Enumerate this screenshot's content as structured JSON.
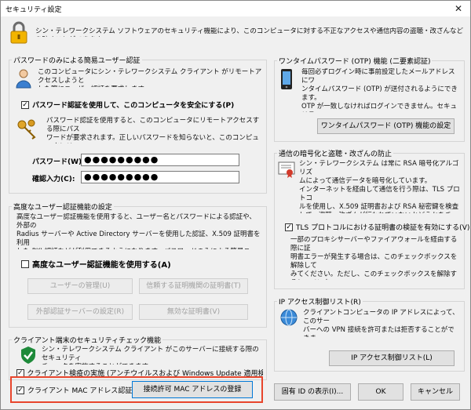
{
  "window": {
    "title": "セキュリティ設定",
    "close_glyph": "✕"
  },
  "header": {
    "description": "シン・テレワークシステム ソフトウェアのセキュリティ機能により、このコンピュータに対する不正なアクセスや通信内容の盗聴・改ざんなどを防ぐことができます。"
  },
  "password_auth": {
    "group_label": "パスワードのみによる簡易ユーザー認証",
    "intro": "このコンピュータにシン・テレワークシステム クライアント がリモートアクセスしようと\nした際にユーザー認証を要求します。",
    "checkbox_label": "パスワード認証を使用して、このコンピュータを安全にする(P)",
    "checked": true,
    "detail": "パスワード認証を使用すると、このコンピュータにリモートアクセスする際にパス\nワードが要求されます。正しいパスワードを知らないと、このコンピュータにリ\nモートアクセスできません。",
    "password_label": "パスワード(W):",
    "password_value": "●●●●●●●●●",
    "confirm_label": "確認入力(C):",
    "confirm_value": "●●●●●●●●●"
  },
  "advanced_auth": {
    "group_label": "高度なユーザー認証機能の設定",
    "intro": "高度なユーザー認証機能を使用すると、ユーザー名とパスワードによる認証や、外部の\nRadius サーバーや Active Directory サーバーを使用した認証、X.509 証明書を利用\nした PKI 認証などが利用できるようになります。パスワードのみによる簡易ユーザー認証\nは利用できなくなります。",
    "checkbox_label": "高度なユーザー認証機能を使用する(A)",
    "checked": false,
    "buttons": [
      "ユーザーの管理(U)",
      "信頼する証明機関の証明書(T)",
      "外部認証サーバーの設定(R)",
      "無効な証明書(V)"
    ]
  },
  "client_check": {
    "group_label": "クライアント端末のセキュリティチェック機能",
    "intro": "シン・テレワークシステム クライアント がこのサーバーに接続する際のセキュリティ\nチェックを実施することができます。",
    "checkbox_label": "クライアント検疫の実施 (アンチウイルスおよび Windows Update 適用検査)",
    "checked": true
  },
  "mac_auth": {
    "checkbox_label": "クライアント MAC アドレス認証",
    "checked": true,
    "button_label": "接続許可 MAC アドレスの登録"
  },
  "otp": {
    "group_label": "ワンタイムパスワード (OTP) 機能 (二要素認証)",
    "text": "毎回必ずログイン時に事前設定したメールアドレスにワ\nンタイムパスワード (OTP) が送付されるようにできます。\nOTP が一致しなければログインできません。セキュリティ\nポリシー上、二要素認証の利用が必須の企業環境で\n利用できます。",
    "button_label": "ワンタイムパスワード (OTP) 機能の設定"
  },
  "encryption": {
    "group_label": "通信の暗号化と盗聴・改ざんの防止",
    "text": "シン・テレワークシステム は常に RSA 暗号化アルゴリズ\nムによって通信データを暗号化しています。\nインターネットを経由して通信を行う際は、TLS プロトコ\nルを使用し、X.509 証明書および RSA 秘密鍵を検査\nして、盗聴・改ざんが行われていないかどうかをチェックす\nることができます。",
    "checkbox_label": "TLS プロトコルにおける証明書の検証を有効にする(V)",
    "checked": true,
    "note": "一部のプロキシサーバーやファイアウォールを経由する際に証\n明書エラーが発生する場合は、このチェックボックスを解除して\nみてください。ただし、このチェックボックスを解除すると、インター\nネット上の第三者によって通信データが盗聴・改ざんされる危\n険性が発生します。"
  },
  "ip_acl": {
    "group_label": "IP アクセス制御リスト(R)",
    "text": "クライアントコンピュータの IP アドレスによって、このサー\nバーへの VPN 接続を許可または拒否することができま\nす。",
    "button_label": "IP アクセス制御リスト(L)"
  },
  "footer": {
    "unique_id_label": "固有 ID の表示(I)...",
    "ok_label": "OK",
    "cancel_label": "キャンセル"
  },
  "colors": {
    "highlight": "#e8452c",
    "focus": "#0078d7",
    "check_green": "#1e8a3a"
  }
}
